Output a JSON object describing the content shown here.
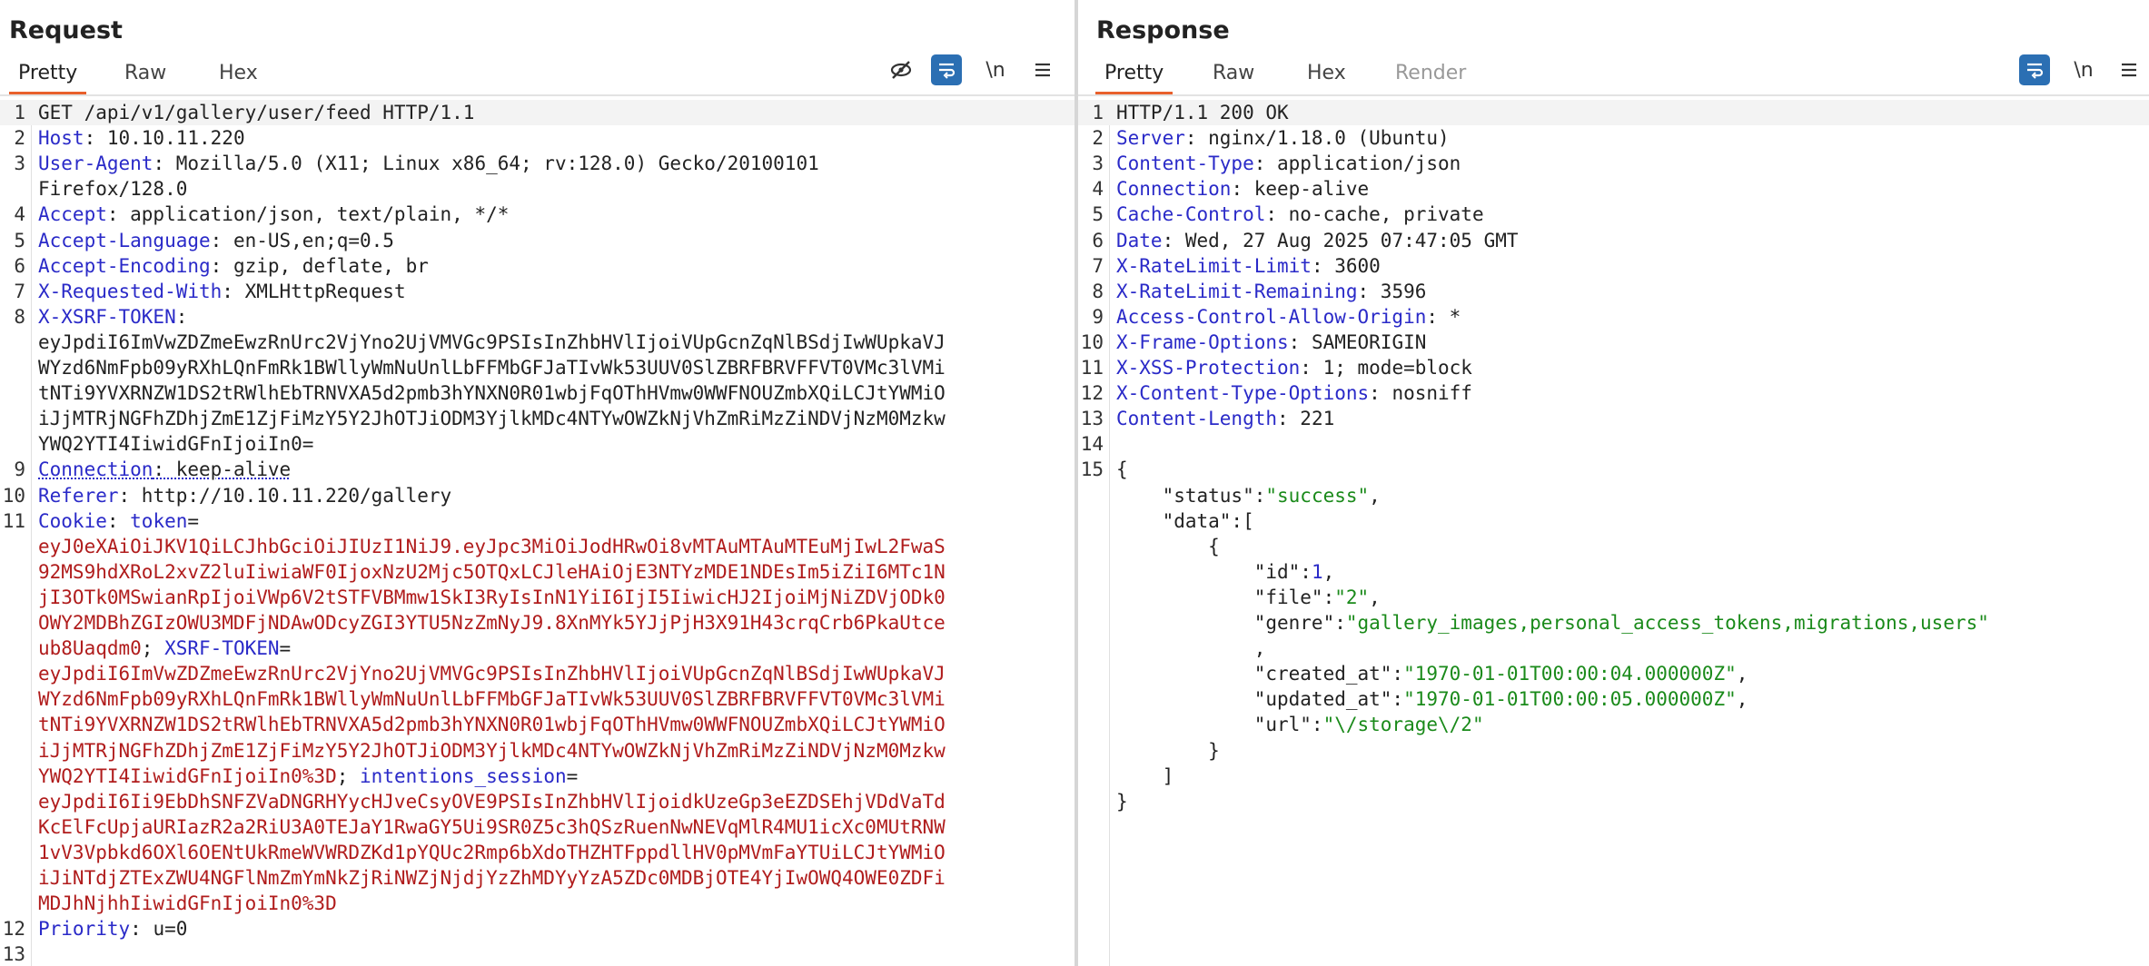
{
  "request": {
    "title": "Request",
    "tabs": [
      "Pretty",
      "Raw",
      "Hex"
    ],
    "active_tab": "Pretty",
    "toolbar": {
      "hide_icon": "eye-slash-icon",
      "wrap_icon": "wrap-icon",
      "newline_label": "\\n",
      "menu_icon": "menu-icon"
    },
    "lines": [
      {
        "n": "1",
        "segs": [
          {
            "t": "v",
            "x": "GET /api/v1/gallery/user/feed HTTP/1.1"
          }
        ]
      },
      {
        "n": "2",
        "segs": [
          {
            "t": "k",
            "x": "Host"
          },
          {
            "t": "v",
            "x": ": 10.10.11.220"
          }
        ]
      },
      {
        "n": "3",
        "segs": [
          {
            "t": "k",
            "x": "User-Agent"
          },
          {
            "t": "v",
            "x": ": Mozilla/5.0 (X11; Linux x86_64; rv:128.0) Gecko/20100101"
          }
        ]
      },
      {
        "n": "",
        "segs": [
          {
            "t": "v",
            "x": "Firefox/128.0"
          }
        ]
      },
      {
        "n": "4",
        "segs": [
          {
            "t": "k",
            "x": "Accept"
          },
          {
            "t": "v",
            "x": ": application/json, text/plain, */*"
          }
        ]
      },
      {
        "n": "5",
        "segs": [
          {
            "t": "k",
            "x": "Accept-Language"
          },
          {
            "t": "v",
            "x": ": en-US,en;q=0.5"
          }
        ]
      },
      {
        "n": "6",
        "segs": [
          {
            "t": "k",
            "x": "Accept-Encoding"
          },
          {
            "t": "v",
            "x": ": gzip, deflate, br"
          }
        ]
      },
      {
        "n": "7",
        "segs": [
          {
            "t": "k",
            "x": "X-Requested-With"
          },
          {
            "t": "v",
            "x": ": XMLHttpRequest"
          }
        ]
      },
      {
        "n": "8",
        "segs": [
          {
            "t": "k",
            "x": "X-XSRF-TOKEN"
          },
          {
            "t": "v",
            "x": ":"
          }
        ]
      },
      {
        "n": "",
        "segs": [
          {
            "t": "v",
            "x": "eyJpdiI6ImVwZDZmeEwzRnUrc2VjYno2UjVMVGc9PSIsInZhbHVlIjoiVUpGcnZqNlBSdjIwWUpkaVJ"
          }
        ]
      },
      {
        "n": "",
        "segs": [
          {
            "t": "v",
            "x": "WYzd6NmFpb09yRXhLQnFmRk1BWllyWmNuUnlLbFFMbGFJaTIvWk53UUV0SlZBRFBRVFFVT0VMc3lVMi"
          }
        ]
      },
      {
        "n": "",
        "segs": [
          {
            "t": "v",
            "x": "tNTi9YVXRNZW1DS2tRWlhEbTRNVXA5d2pmb3hYNXN0R01wbjFqOThHVmw0WWFNOUZmbXQiLCJtYWMiO"
          }
        ]
      },
      {
        "n": "",
        "segs": [
          {
            "t": "v",
            "x": "iJjMTRjNGFhZDhjZmE1ZjFiMzY5Y2JhOTJiODM3YjlkMDc4NTYwOWZkNjVhZmRiMzZiNDVjNzM0Mzkw"
          }
        ]
      },
      {
        "n": "",
        "segs": [
          {
            "t": "v",
            "x": "YWQ2YTI4IiwidGFnIjoiIn0="
          }
        ]
      },
      {
        "n": "9",
        "segs": [
          {
            "t": "ku",
            "x": "Connection"
          },
          {
            "t": "vu",
            "x": ": keep-alive"
          }
        ]
      },
      {
        "n": "10",
        "segs": [
          {
            "t": "k",
            "x": "Referer"
          },
          {
            "t": "v",
            "x": ": http://10.10.11.220/gallery"
          }
        ]
      },
      {
        "n": "11",
        "segs": [
          {
            "t": "k",
            "x": "Cookie"
          },
          {
            "t": "v",
            "x": ": "
          },
          {
            "t": "k",
            "x": "token"
          },
          {
            "t": "v",
            "x": "="
          }
        ]
      },
      {
        "n": "",
        "segs": [
          {
            "t": "c",
            "x": "eyJ0eXAiOiJKV1QiLCJhbGciOiJIUzI1NiJ9.eyJpc3MiOiJodHRwOi8vMTAuMTAuMTEuMjIwL2FwaS"
          }
        ]
      },
      {
        "n": "",
        "segs": [
          {
            "t": "c",
            "x": "92MS9hdXRoL2xvZ2luIiwiaWF0IjoxNzU2Mjc5OTQxLCJleHAiOjE3NTYzMDE1NDEsIm5iZiI6MTc1N"
          }
        ]
      },
      {
        "n": "",
        "segs": [
          {
            "t": "c",
            "x": "jI3OTk0MSwianRpIjoiVWp6V2tSTFVBMmw1SkI3RyIsInN1YiI6IjI5IiwicHJ2IjoiMjNiZDVjODk0"
          }
        ]
      },
      {
        "n": "",
        "segs": [
          {
            "t": "c",
            "x": "OWY2MDBhZGIzOWU3MDFjNDAwODcyZGI3YTU5NzZmNyJ9.8XnMYk5YJjPjH3X91H43crqCrb6PkaUtce"
          }
        ]
      },
      {
        "n": "",
        "segs": [
          {
            "t": "c",
            "x": "ub8Uaqdm0"
          },
          {
            "t": "v",
            "x": "; "
          },
          {
            "t": "k",
            "x": "XSRF-TOKEN"
          },
          {
            "t": "v",
            "x": "="
          }
        ]
      },
      {
        "n": "",
        "segs": [
          {
            "t": "c",
            "x": "eyJpdiI6ImVwZDZmeEwzRnUrc2VjYno2UjVMVGc9PSIsInZhbHVlIjoiVUpGcnZqNlBSdjIwWUpkaVJ"
          }
        ]
      },
      {
        "n": "",
        "segs": [
          {
            "t": "c",
            "x": "WYzd6NmFpb09yRXhLQnFmRk1BWllyWmNuUnlLbFFMbGFJaTIvWk53UUV0SlZBRFBRVFFVT0VMc3lVMi"
          }
        ]
      },
      {
        "n": "",
        "segs": [
          {
            "t": "c",
            "x": "tNTi9YVXRNZW1DS2tRWlhEbTRNVXA5d2pmb3hYNXN0R01wbjFqOThHVmw0WWFNOUZmbXQiLCJtYWMiO"
          }
        ]
      },
      {
        "n": "",
        "segs": [
          {
            "t": "c",
            "x": "iJjMTRjNGFhZDhjZmE1ZjFiMzY5Y2JhOTJiODM3YjlkMDc4NTYwOWZkNjVhZmRiMzZiNDVjNzM0Mzkw"
          }
        ]
      },
      {
        "n": "",
        "segs": [
          {
            "t": "c",
            "x": "YWQ2YTI4IiwidGFnIjoiIn0%3D"
          },
          {
            "t": "v",
            "x": "; "
          },
          {
            "t": "k",
            "x": "intentions_session"
          },
          {
            "t": "v",
            "x": "="
          }
        ]
      },
      {
        "n": "",
        "segs": [
          {
            "t": "c",
            "x": "eyJpdiI6Ii9EbDhSNFZVaDNGRHYycHJveCsyOVE9PSIsInZhbHVlIjoidkUzeGp3eEZDSEhjVDdVaTd"
          }
        ]
      },
      {
        "n": "",
        "segs": [
          {
            "t": "c",
            "x": "KcElFcUpjaURIazR2a2RiU3A0TEJaY1RwaGY5Ui9SR0Z5c3hQSzRuenNwNEVqMlR4MU1icXc0MUtRNW"
          }
        ]
      },
      {
        "n": "",
        "segs": [
          {
            "t": "c",
            "x": "1vV3Vpbkd6OXl6OENtUkRmeWVWRDZKd1pYQUc2Rmp6bXdoTHZHTFppdllHV0pMVmFaYTUiLCJtYWMiO"
          }
        ]
      },
      {
        "n": "",
        "segs": [
          {
            "t": "c",
            "x": "iJiNTdjZTExZWU4NGFlNmZmYmNkZjRiNWZjNjdjYzZhMDYyYzA5ZDc0MDBjOTE4YjIwOWQ4OWE0ZDFi"
          }
        ]
      },
      {
        "n": "",
        "segs": [
          {
            "t": "c",
            "x": "MDJhNjhhIiwidGFnIjoiIn0%3D"
          }
        ]
      },
      {
        "n": "12",
        "segs": [
          {
            "t": "k",
            "x": "Priority"
          },
          {
            "t": "v",
            "x": ": u=0"
          }
        ]
      },
      {
        "n": "13",
        "segs": []
      }
    ]
  },
  "response": {
    "title": "Response",
    "tabs": [
      "Pretty",
      "Raw",
      "Hex",
      "Render"
    ],
    "active_tab": "Pretty",
    "toolbar": {
      "wrap_icon": "wrap-icon",
      "newline_label": "\\n",
      "menu_icon": "menu-icon"
    },
    "lines": [
      {
        "n": "1",
        "segs": [
          {
            "t": "v",
            "x": "HTTP/1.1 200 OK"
          }
        ]
      },
      {
        "n": "2",
        "segs": [
          {
            "t": "k",
            "x": "Server"
          },
          {
            "t": "v",
            "x": ": nginx/1.18.0 (Ubuntu)"
          }
        ]
      },
      {
        "n": "3",
        "segs": [
          {
            "t": "k",
            "x": "Content-Type"
          },
          {
            "t": "v",
            "x": ": application/json"
          }
        ]
      },
      {
        "n": "4",
        "segs": [
          {
            "t": "k",
            "x": "Connection"
          },
          {
            "t": "v",
            "x": ": keep-alive"
          }
        ]
      },
      {
        "n": "5",
        "segs": [
          {
            "t": "k",
            "x": "Cache-Control"
          },
          {
            "t": "v",
            "x": ": no-cache, private"
          }
        ]
      },
      {
        "n": "6",
        "segs": [
          {
            "t": "k",
            "x": "Date"
          },
          {
            "t": "v",
            "x": ": Wed, 27 Aug 2025 07:47:05 GMT"
          }
        ]
      },
      {
        "n": "7",
        "segs": [
          {
            "t": "k",
            "x": "X-RateLimit-Limit"
          },
          {
            "t": "v",
            "x": ": 3600"
          }
        ]
      },
      {
        "n": "8",
        "segs": [
          {
            "t": "k",
            "x": "X-RateLimit-Remaining"
          },
          {
            "t": "v",
            "x": ": 3596"
          }
        ]
      },
      {
        "n": "9",
        "segs": [
          {
            "t": "k",
            "x": "Access-Control-Allow-Origin"
          },
          {
            "t": "v",
            "x": ": *"
          }
        ]
      },
      {
        "n": "10",
        "segs": [
          {
            "t": "k",
            "x": "X-Frame-Options"
          },
          {
            "t": "v",
            "x": ": SAMEORIGIN"
          }
        ]
      },
      {
        "n": "11",
        "segs": [
          {
            "t": "k",
            "x": "X-XSS-Protection"
          },
          {
            "t": "v",
            "x": ": 1; mode=block"
          }
        ]
      },
      {
        "n": "12",
        "segs": [
          {
            "t": "k",
            "x": "X-Content-Type-Options"
          },
          {
            "t": "v",
            "x": ": nosniff"
          }
        ]
      },
      {
        "n": "13",
        "segs": [
          {
            "t": "k",
            "x": "Content-Length"
          },
          {
            "t": "v",
            "x": ": 221"
          }
        ]
      },
      {
        "n": "14",
        "segs": []
      },
      {
        "n": "15",
        "segs": [
          {
            "t": "v",
            "x": "{"
          }
        ]
      },
      {
        "n": "",
        "segs": [
          {
            "t": "v",
            "x": "    \"status\":"
          },
          {
            "t": "s",
            "x": "\"success\""
          },
          {
            "t": "v",
            "x": ","
          }
        ]
      },
      {
        "n": "",
        "segs": [
          {
            "t": "v",
            "x": "    \"data\":["
          }
        ]
      },
      {
        "n": "",
        "segs": [
          {
            "t": "v",
            "x": "        {"
          }
        ]
      },
      {
        "n": "",
        "segs": [
          {
            "t": "v",
            "x": "            \"id\":"
          },
          {
            "t": "k",
            "x": "1"
          },
          {
            "t": "v",
            "x": ","
          }
        ]
      },
      {
        "n": "",
        "segs": [
          {
            "t": "v",
            "x": "            \"file\":"
          },
          {
            "t": "s",
            "x": "\"2\""
          },
          {
            "t": "v",
            "x": ","
          }
        ]
      },
      {
        "n": "",
        "segs": [
          {
            "t": "v",
            "x": "            \"genre\":"
          },
          {
            "t": "s",
            "x": "\"gallery_images,personal_access_tokens,migrations,users\""
          }
        ]
      },
      {
        "n": "",
        "segs": [
          {
            "t": "v",
            "x": "            ,"
          }
        ]
      },
      {
        "n": "",
        "segs": [
          {
            "t": "v",
            "x": "            \"created_at\":"
          },
          {
            "t": "s",
            "x": "\"1970-01-01T00:00:04.000000Z\""
          },
          {
            "t": "v",
            "x": ","
          }
        ]
      },
      {
        "n": "",
        "segs": [
          {
            "t": "v",
            "x": "            \"updated_at\":"
          },
          {
            "t": "s",
            "x": "\"1970-01-01T00:00:05.000000Z\""
          },
          {
            "t": "v",
            "x": ","
          }
        ]
      },
      {
        "n": "",
        "segs": [
          {
            "t": "v",
            "x": "            \"url\":"
          },
          {
            "t": "s",
            "x": "\"\\/storage\\/2\""
          }
        ]
      },
      {
        "n": "",
        "segs": [
          {
            "t": "v",
            "x": "        }"
          }
        ]
      },
      {
        "n": "",
        "segs": [
          {
            "t": "v",
            "x": "    ]"
          }
        ]
      },
      {
        "n": "",
        "segs": [
          {
            "t": "v",
            "x": "}"
          }
        ]
      }
    ]
  },
  "colors": {
    "accent": "#e8602c",
    "key": "#2a2ac8",
    "cookie_value": "#b01c1c",
    "json_string": "#1a8a1a",
    "toggle_on": "#2b6fb3"
  }
}
